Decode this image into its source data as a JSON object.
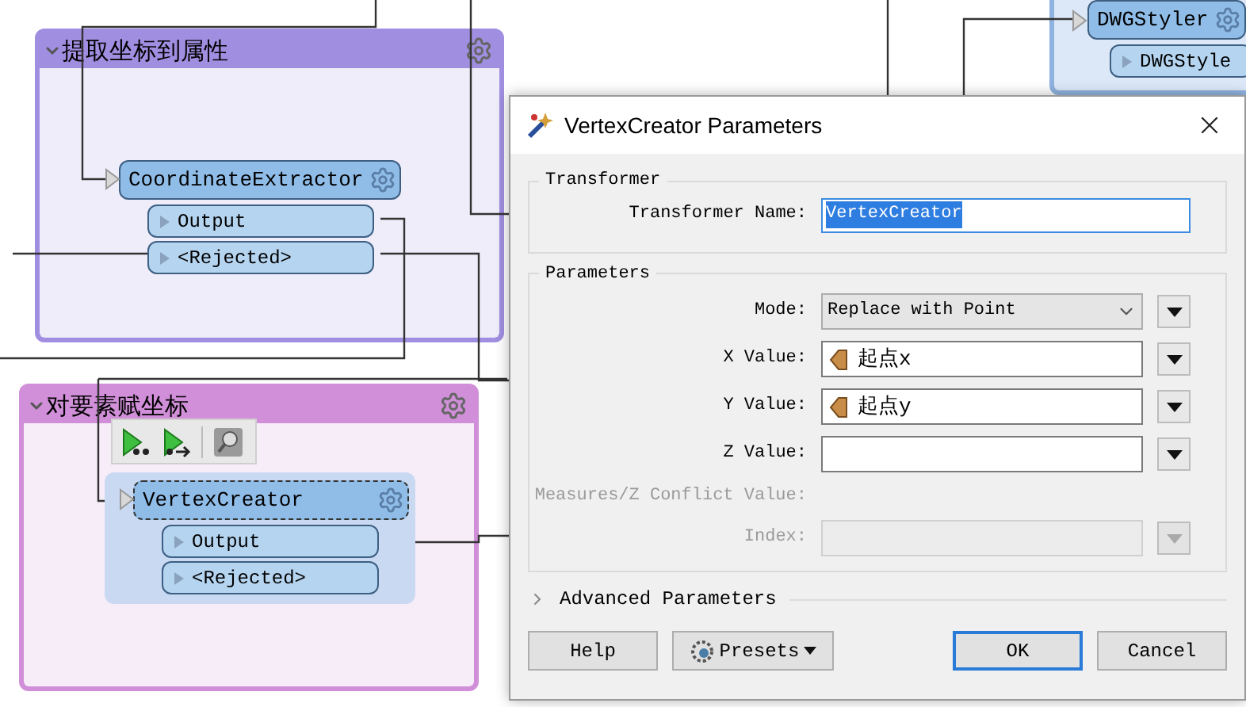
{
  "bookmarks": [
    {
      "title": "提取坐标到属性",
      "expanded": true,
      "color": "#a08ee0"
    },
    {
      "title": "对要素赋坐标",
      "expanded": true,
      "color": "#d08fd8"
    }
  ],
  "transformers": [
    {
      "name": "CoordinateExtractor",
      "selected": false,
      "ports": [
        "Output",
        "<Rejected>"
      ]
    },
    {
      "name": "VertexCreator",
      "selected": true,
      "ports": [
        "Output",
        "<Rejected>"
      ]
    },
    {
      "name": "DWGStyler",
      "selected": false,
      "ports": [
        "DWGStyle"
      ]
    }
  ],
  "dialog": {
    "title": "VertexCreator Parameters",
    "transformer_group": {
      "heading": "Transformer",
      "label": "Transformer Name:",
      "value": "VertexCreator",
      "value_selected": true
    },
    "parameters_group": {
      "heading": "Parameters",
      "rows": [
        {
          "kind": "select",
          "label": "Mode:",
          "value": "Replace with Point",
          "disabled": false
        },
        {
          "kind": "attribute",
          "label": "X Value:",
          "value": "起点x",
          "disabled": false
        },
        {
          "kind": "attribute",
          "label": "Y Value:",
          "value": "起点y",
          "disabled": false
        },
        {
          "kind": "text",
          "label": "Z Value:",
          "disabled": false
        },
        {
          "kind": "label",
          "label": "Measures/Z Conflict Value:",
          "disabled": true
        },
        {
          "kind": "text",
          "label": "Index:",
          "disabled": true
        }
      ]
    },
    "advanced": {
      "label": "Advanced Parameters",
      "expanded": false
    },
    "buttons": [
      {
        "kind": "plain",
        "label": "Help",
        "default": false
      },
      {
        "kind": "menu",
        "label": "Presets",
        "default": false
      },
      {
        "kind": "plain",
        "label": "OK",
        "default": true
      },
      {
        "kind": "plain",
        "label": "Cancel",
        "default": false
      }
    ]
  }
}
